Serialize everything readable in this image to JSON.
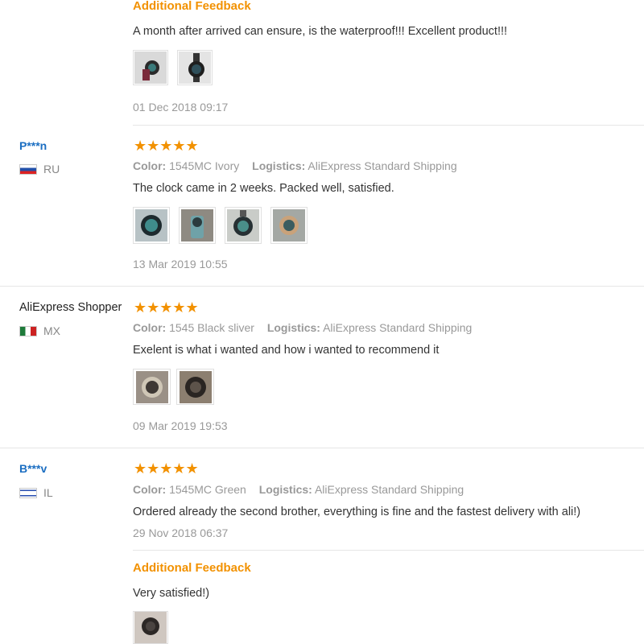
{
  "reviews": [
    {
      "additional": {
        "title": "Additional Feedback",
        "text": "A month after arrived can ensure, is the waterproof!!! Excellent product!!!",
        "date": "01 Dec 2018 09:17",
        "photos": [
          "watch-photo",
          "watch-photo"
        ]
      }
    },
    {
      "user": "P***n",
      "country": "RU",
      "stars": "★★★★★",
      "color_label": "Color:",
      "color_value": "1545MC Ivory",
      "logistics_label": "Logistics:",
      "logistics_value": "AliExpress Standard Shipping",
      "text": "The clock came in 2 weeks. Packed well, satisfied.",
      "date": "13 Mar 2019 10:55",
      "photos": [
        "watch-photo",
        "watch-photo",
        "watch-photo",
        "watch-photo"
      ]
    },
    {
      "user": "AliExpress Shopper",
      "country": "MX",
      "stars": "★★★★★",
      "color_label": "Color:",
      "color_value": "1545 Black sliver",
      "logistics_label": "Logistics:",
      "logistics_value": "AliExpress Standard Shipping",
      "text": "Exelent is what i wanted and how i wanted to recommend it",
      "date": "09 Mar 2019 19:53",
      "photos": [
        "watch-photo",
        "watch-photo"
      ]
    },
    {
      "user": "B***v",
      "country": "IL",
      "stars": "★★★★★",
      "color_label": "Color:",
      "color_value": "1545MC Green",
      "logistics_label": "Logistics:",
      "logistics_value": "AliExpress Standard Shipping",
      "text": "Ordered already the second brother, everything is fine and the fastest delivery with ali!)",
      "date": "29 Nov 2018 06:37",
      "additional": {
        "title": "Additional Feedback",
        "text": "Very satisfied!)",
        "photos": [
          "watch-photo"
        ]
      }
    }
  ],
  "colors": {
    "accent": "#f29100",
    "username": "#1b6ec2",
    "muted": "#999999",
    "text": "#333333"
  }
}
